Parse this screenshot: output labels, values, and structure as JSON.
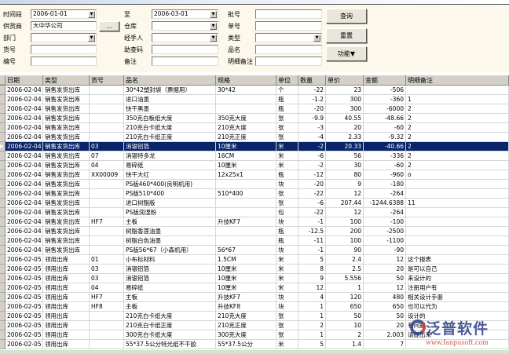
{
  "filters": {
    "time_label": "时间段",
    "date_from": "2006-01-01",
    "to_label": "至",
    "date_to": "2006-03-01",
    "supplier_label": "供货商",
    "supplier": "大中华公司",
    "browse_label": "...",
    "warehouse_label": "仓库",
    "warehouse": "",
    "dept_label": "部门",
    "dept": "",
    "handler_label": "经手人",
    "handler": "",
    "item_no_label": "货号",
    "item_no": "",
    "help_code_label": "助查码",
    "help_code": "",
    "code_label": "编号",
    "code": "",
    "remark_label": "备注",
    "remark": "",
    "batch_label": "批号",
    "batch": "",
    "order_label": "单号",
    "order": "",
    "type_label": "类型",
    "type": "",
    "name_label": "品名",
    "name": "",
    "detail_remark_label": "明细备注",
    "detail_remark": ""
  },
  "buttons": {
    "query": "查询",
    "reset": "重置",
    "function": "功能▼"
  },
  "table": {
    "columns": [
      "日期",
      "类型",
      "货号",
      "品名",
      "规格",
      "单位",
      "数量",
      "单价",
      "金额",
      "明细备注"
    ],
    "selected_index": 6,
    "rows": [
      [
        "2006-02-04",
        "销售发货出库",
        "",
        "30*42塑封袋（票据用）",
        "30*42",
        "个",
        "-22",
        "23",
        "-506",
        ""
      ],
      [
        "2006-02-04",
        "销售发货出库",
        "",
        "进口油墨",
        "",
        "瓶",
        "-1.2",
        "300",
        "-360",
        "1"
      ],
      [
        "2006-02-04",
        "销售发货出库",
        "",
        "快干黑墨",
        "",
        "瓶",
        "-20",
        "300",
        "-6000",
        "2"
      ],
      [
        "2006-02-04",
        "销售发货出库",
        "",
        "350克白板纸大度",
        "350克大度",
        "张",
        "-9.9",
        "40.55",
        "-48.66",
        "2"
      ],
      [
        "2006-02-04",
        "销售发货出库",
        "",
        "210克白卡纸大度",
        "210克大度",
        "张",
        "-3",
        "20",
        "-60",
        "2"
      ],
      [
        "2006-02-04",
        "销售发货出库",
        "",
        "210克白卡纸正度",
        "210克正度",
        "张",
        "-4",
        "2.33",
        "-9.32",
        "2"
      ],
      [
        "2006-02-04",
        "销售发货出库",
        "03",
        "消银铝箔",
        "10厘米",
        "米",
        "-2",
        "20.33",
        "-40.66",
        "2"
      ],
      [
        "2006-02-04",
        "销售发货出库",
        "07",
        "消银特多龙",
        "16CM",
        "米",
        "-6",
        "56",
        "-336",
        "2"
      ],
      [
        "2006-02-04",
        "销售发货出库",
        "04",
        "易碎纸",
        "10厘米",
        "米",
        "-2",
        "30",
        "-60",
        "2"
      ],
      [
        "2006-02-04",
        "销售发货出库",
        "XX00009",
        "快干大红",
        "12x25x1",
        "瓶",
        "-12",
        "80",
        "-960",
        "o"
      ],
      [
        "2006-02-04",
        "销售发货出库",
        "",
        "PS版460*400(良明机用)",
        "",
        "块",
        "-20",
        "9",
        "-180",
        ""
      ],
      [
        "2006-02-04",
        "销售发货出库",
        "",
        "PS版510*400",
        "510*400",
        "张",
        "-22",
        "12",
        "-264",
        ""
      ],
      [
        "2006-02-04",
        "销售发货出库",
        "",
        "进口树脂版",
        "",
        "张",
        "-6",
        "207.44",
        "-1244.6388",
        "11"
      ],
      [
        "2006-02-04",
        "销售发货出库",
        "",
        "PS版润湿粉",
        "",
        "包",
        "-22",
        "12",
        "-264",
        ""
      ],
      [
        "2006-02-04",
        "销售发货出库",
        "HF7",
        "主板",
        "升技KF7",
        "块",
        "-1",
        "100",
        "-100",
        ""
      ],
      [
        "2006-02-04",
        "销售发货出库",
        "",
        "树脂香莲油墨",
        "",
        "瓶",
        "-12.5",
        "200",
        "-2500",
        ""
      ],
      [
        "2006-02-04",
        "销售发货出库",
        "",
        "树脂白色油墨",
        "",
        "瓶",
        "-11",
        "100",
        "-1100",
        ""
      ],
      [
        "2006-02-04",
        "销售发货出库",
        "",
        "PS版56*67（小森机用）",
        "56*67",
        "块",
        "-1",
        "90",
        "-90",
        ""
      ],
      [
        "2006-02-05",
        "领用出库",
        "01",
        "小布标材料",
        "1.5CM",
        "米",
        "5",
        "2.4",
        "12",
        "这个报表"
      ],
      [
        "2006-02-05",
        "领用出库",
        "03",
        "消银铝箔",
        "10厘米",
        "米",
        "8",
        "2.5",
        "20",
        "是可以自己"
      ],
      [
        "2006-02-05",
        "领用出库",
        "03",
        "消银铝箔",
        "10厘米",
        "米",
        "9",
        "5.556",
        "50",
        "来设计的"
      ],
      [
        "2006-02-05",
        "领用出库",
        "04",
        "易碎纸",
        "10厘米",
        "米",
        "12",
        "1",
        "12",
        "注册用户有"
      ],
      [
        "2006-02-05",
        "领用出库",
        "HF7",
        "主板",
        "升技KF7",
        "块",
        "4",
        "120",
        "480",
        "相关设计手册"
      ],
      [
        "2006-02-05",
        "领用出库",
        "HF8",
        "主板",
        "升技KF8",
        "块",
        "1",
        "650",
        "650",
        "也可以代为"
      ],
      [
        "2006-02-05",
        "领用出库",
        "",
        "210克白卡纸大度",
        "210克大度",
        "张",
        "1",
        "50",
        "50",
        "设计的"
      ],
      [
        "2006-02-05",
        "领用出库",
        "",
        "210克白卡纸正度",
        "210克正度",
        "张",
        "2",
        "10",
        "20",
        "有问题"
      ],
      [
        "2006-02-05",
        "领用出库",
        "",
        "300克白卡纸大度",
        "300克大度",
        "张",
        "1",
        "2",
        "2.003",
        "请提出来"
      ],
      [
        "2006-02-05",
        "领用出库",
        "",
        "55*37.5公分特光纸不干胶",
        "55*37.5公分",
        "米",
        "5",
        "1.4",
        "7",
        ""
      ]
    ]
  },
  "watermark": {
    "brand": "泛普软件",
    "url": "www.fanpusoft.com"
  }
}
